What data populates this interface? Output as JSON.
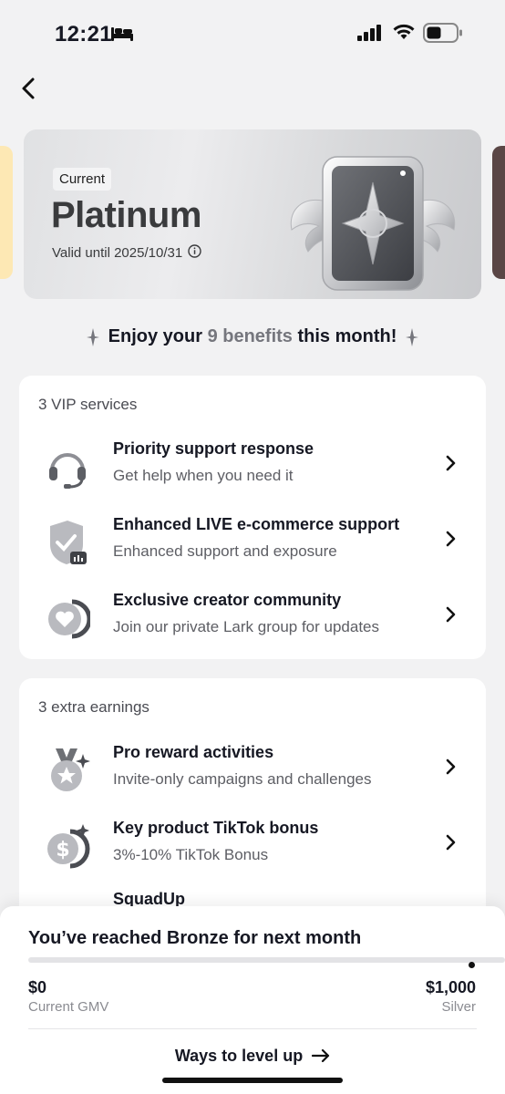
{
  "status_bar": {
    "time": "12:21",
    "icons": [
      "bed-icon",
      "cellular-signal-icon",
      "wifi-icon",
      "battery-icon"
    ]
  },
  "nav": {
    "back_icon": "chevron-left-icon"
  },
  "tier_card": {
    "badge": "Current",
    "tier_name": "Platinum",
    "valid_text": "Valid until 2025/10/31",
    "info_icon": "info-icon",
    "art_icon": "platinum-winged-badge-icon"
  },
  "headline": {
    "prefix": "Enjoy your",
    "highlight": "9 benefits",
    "suffix": "this month!",
    "accent_color": "#75767d"
  },
  "services": {
    "title": "3 VIP services",
    "items": [
      {
        "icon": "headset-icon",
        "title": "Priority support response",
        "subtitle": "Get help when you need it"
      },
      {
        "icon": "shield-check-live-icon",
        "title": "Enhanced LIVE e-commerce support",
        "subtitle": "Enhanced support and exposure"
      },
      {
        "icon": "heart-chat-icon",
        "title": "Exclusive creator community",
        "subtitle": "Join our private Lark group for updates"
      }
    ]
  },
  "earnings": {
    "title": "3 extra earnings",
    "items": [
      {
        "icon": "medal-star-icon",
        "title": "Pro reward activities",
        "subtitle": "Invite-only campaigns and challenges"
      },
      {
        "icon": "dollar-coin-icon",
        "title": "Key product TikTok bonus",
        "subtitle": "3%-10% TikTok Bonus"
      },
      {
        "icon": "squad-icon",
        "title": "SquadUp",
        "subtitle": ""
      }
    ]
  },
  "bottom_sheet": {
    "title": "You’ve reached Bronze for next month",
    "progress_fraction": 0.0,
    "current_value": "$0",
    "current_label": "Current GMV",
    "target_value": "$1,000",
    "target_label": "Silver",
    "cta_label": "Ways to level up",
    "cta_icon": "arrow-right-icon"
  }
}
